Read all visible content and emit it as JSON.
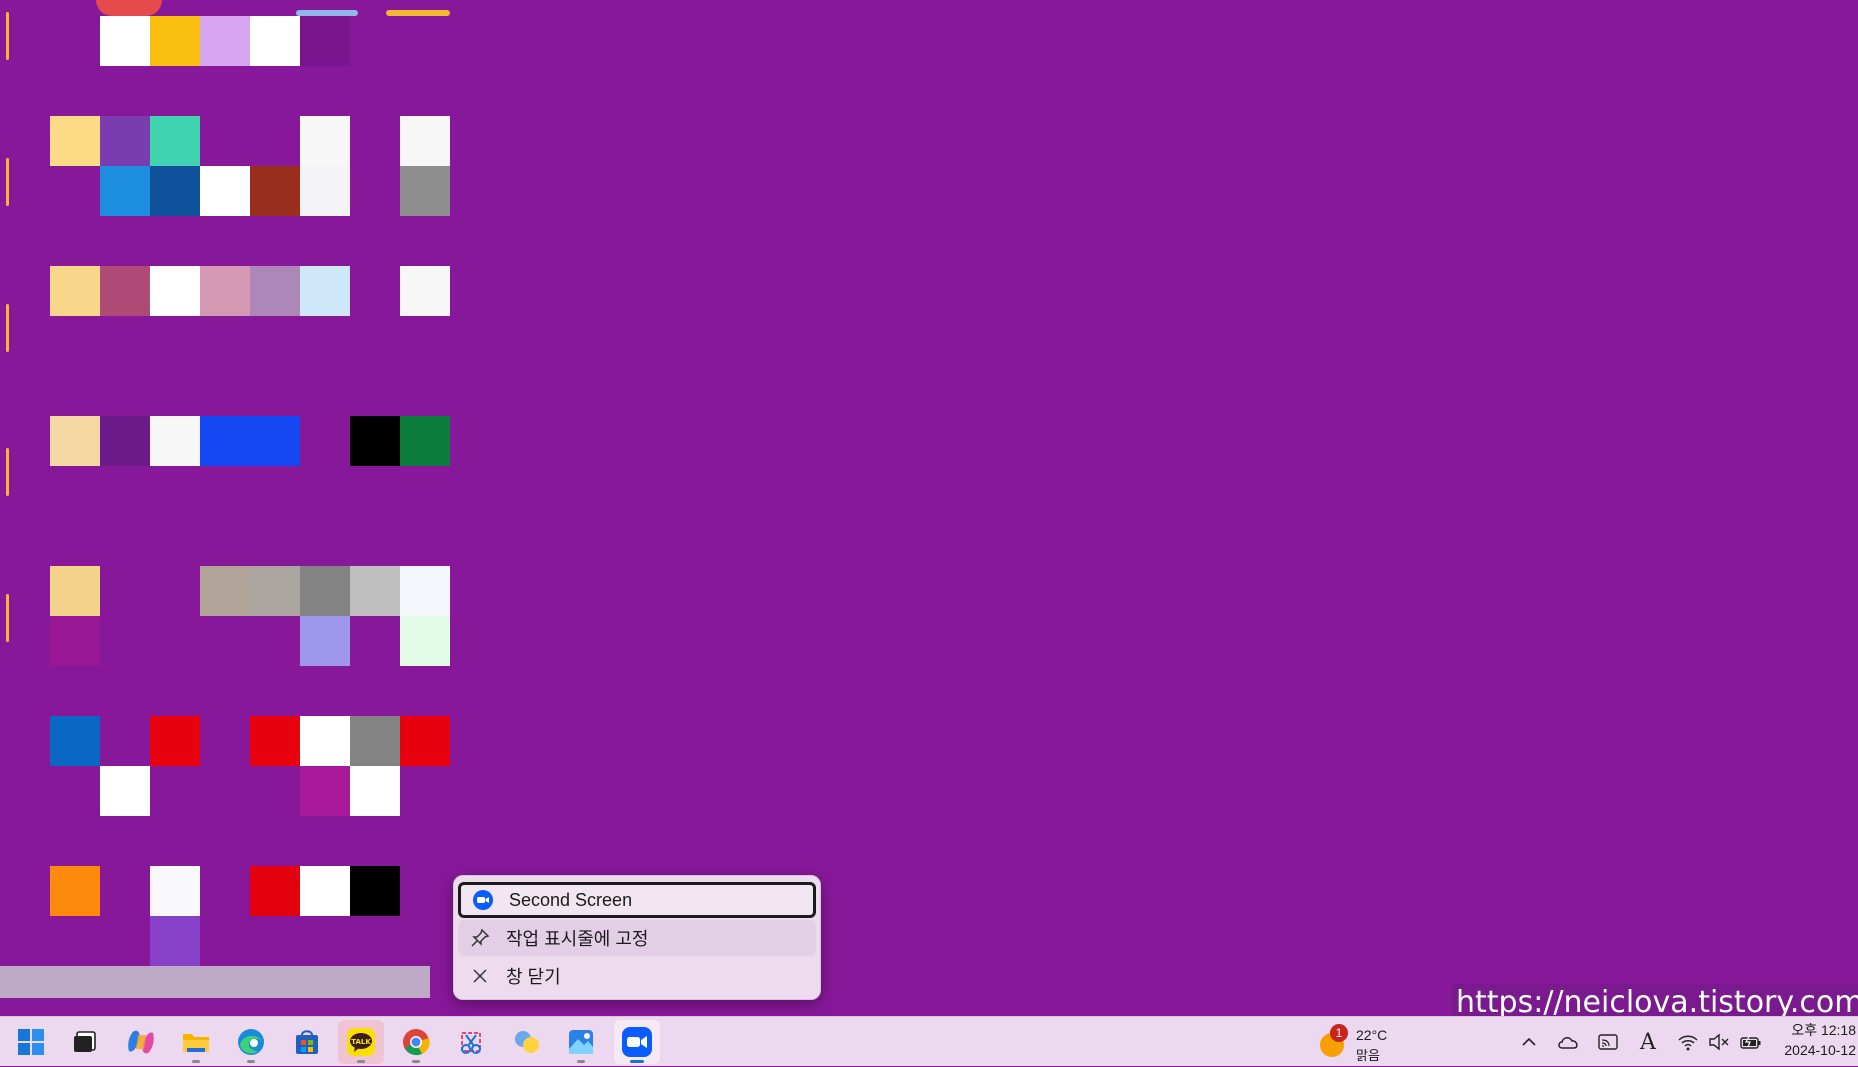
{
  "context_menu": {
    "items": [
      {
        "label": "Second Screen",
        "icon": "zoom-app-icon"
      },
      {
        "label": "작업 표시줄에 고정",
        "icon": "pin-icon"
      },
      {
        "label": "창 닫기",
        "icon": "close-icon"
      }
    ]
  },
  "watermark": "https://neiclova.tistory.com",
  "taskbar": {
    "apps": [
      {
        "name": "start-button",
        "icon": "windows-logo-icon"
      },
      {
        "name": "task-view",
        "icon": "task-view-icon"
      },
      {
        "name": "copilot",
        "icon": "copilot-icon"
      },
      {
        "name": "file-explorer",
        "icon": "folder-icon"
      },
      {
        "name": "edge",
        "icon": "edge-icon"
      },
      {
        "name": "microsoft-store",
        "icon": "store-icon"
      },
      {
        "name": "kakaotalk",
        "icon": "kakaotalk-icon"
      },
      {
        "name": "chrome",
        "icon": "chrome-icon"
      },
      {
        "name": "snipping-tool",
        "icon": "snipping-icon"
      },
      {
        "name": "chat-app",
        "icon": "chat-bubbles-icon"
      },
      {
        "name": "photos",
        "icon": "photos-icon"
      },
      {
        "name": "zoom",
        "icon": "zoom-app-icon"
      }
    ],
    "kakao_label": "TALK",
    "weather": {
      "temp": "22°C",
      "condition": "맑음",
      "badge": "1"
    },
    "tray_icons": [
      "chevron-up-icon",
      "onedrive-cloud-icon",
      "cast-icon",
      "ime-a-icon",
      "wifi-icon",
      "speaker-muted-icon",
      "battery-charging-icon"
    ],
    "ime_label": "A",
    "clock": {
      "time": "오후 12:18",
      "date": "2024-10-12"
    }
  },
  "colors": {
    "desktop": "#87189a",
    "taskbar": "#ecd9ef",
    "menu": "#ecdcee"
  }
}
